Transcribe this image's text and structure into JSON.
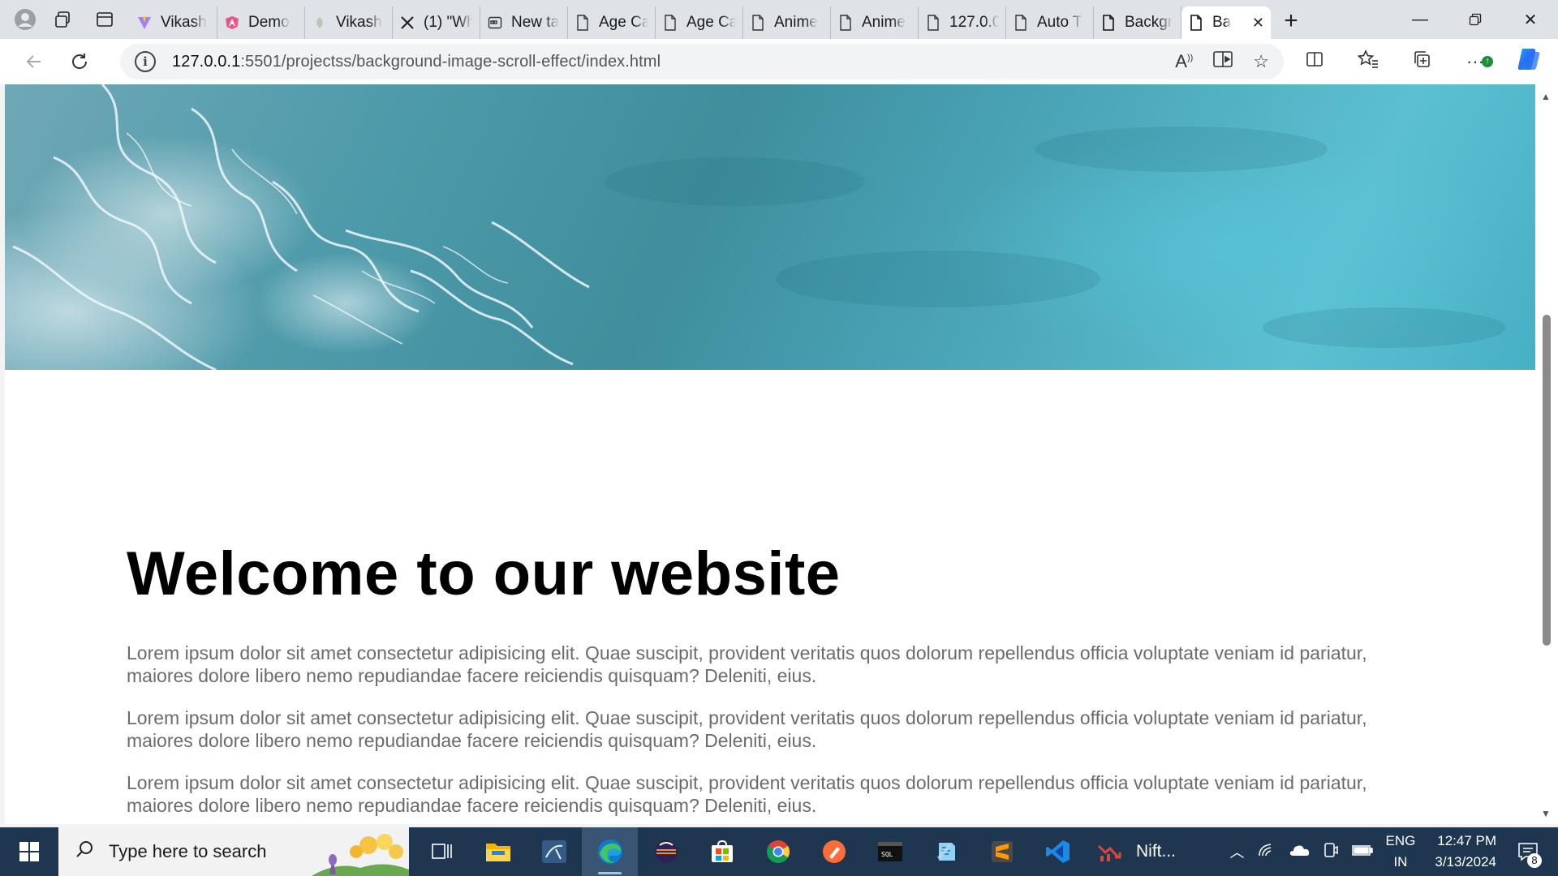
{
  "browser": {
    "tabs": [
      {
        "title": "Vikash",
        "favicon": "vite-icon"
      },
      {
        "title": "Demo",
        "favicon": "angular-icon"
      },
      {
        "title": "Vikash",
        "favicon": "leaf-icon"
      },
      {
        "title": "(1) \"Wh",
        "favicon": "x-icon"
      },
      {
        "title": "New ta",
        "favicon": "newtab-icon"
      },
      {
        "title": "Age Ca",
        "favicon": "page-icon"
      },
      {
        "title": "Age Ca",
        "favicon": "page-icon"
      },
      {
        "title": "Anime",
        "favicon": "page-icon"
      },
      {
        "title": "Anime",
        "favicon": "page-icon"
      },
      {
        "title": "127.0.0",
        "favicon": "page-icon"
      },
      {
        "title": "Auto T",
        "favicon": "page-icon"
      },
      {
        "title": "Backgr",
        "favicon": "page-icon"
      }
    ],
    "active_tab": {
      "title": "Ba",
      "favicon": "page-icon"
    },
    "address": {
      "host": "127.0.0.1",
      "rest": ":5501/projectss/background-image-scroll-effect/index.html"
    }
  },
  "page": {
    "headline": "Welcome to our website",
    "paragraphs": [
      "Lorem ipsum dolor sit amet consectetur adipisicing elit. Quae suscipit, provident veritatis quos dolorum repellendus officia voluptate veniam id pariatur, maiores dolore libero nemo repudiandae facere reiciendis quisquam? Deleniti, eius.",
      "Lorem ipsum dolor sit amet consectetur adipisicing elit. Quae suscipit, provident veritatis quos dolorum repellendus officia voluptate veniam id pariatur, maiores dolore libero nemo repudiandae facere reiciendis quisquam? Deleniti, eius.",
      "Lorem ipsum dolor sit amet consectetur adipisicing elit. Quae suscipit, provident veritatis quos dolorum repellendus officia voluptate veniam id pariatur, maiores dolore libero nemo repudiandae facere reiciendis quisquam? Deleniti, eius."
    ],
    "hero_image": "ocean-waves-aerial",
    "scroll_fraction": 0.36
  },
  "taskbar": {
    "search_placeholder": "Type here to search",
    "apps": [
      "task-view-icon",
      "file-explorer-icon",
      "mysql-workbench-icon",
      "edge-icon",
      "eclipse-icon",
      "microsoft-store-icon",
      "chrome-icon",
      "postman-icon",
      "mysql-cli-icon",
      "notepad-icon",
      "sublime-text-icon",
      "vscode-icon"
    ],
    "active_app": "edge-icon",
    "stock_widget": "Nift...",
    "language": {
      "line1": "ENG",
      "line2": "IN"
    },
    "time": "12:47 PM",
    "date": "3/13/2024",
    "notification_count": "8"
  },
  "colors": {
    "taskbar": "#1f3650",
    "tab_strip": "#dfe3e8",
    "paragraph_text": "#6b6b6b"
  }
}
